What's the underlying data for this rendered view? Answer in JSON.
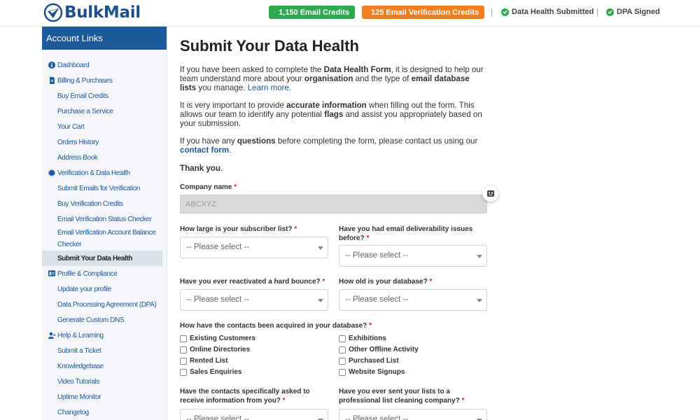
{
  "header": {
    "logo_text": "BulkMail",
    "email_credits": "1,150 Email Credits",
    "verification_credits": "125 Email Verification Credits",
    "separator": "|",
    "data_health_status": "Data Health Submitted",
    "dpa_status": "DPA Signed",
    "colors": {
      "brand": "#1e4f8f",
      "green": "#2fa84f",
      "orange": "#f37f20"
    }
  },
  "sidebar": {
    "title": "Account Links",
    "items": [
      {
        "label": "Dashboard",
        "type": "section",
        "icon": "info-icon"
      },
      {
        "label": "Billing & Purchases",
        "type": "section",
        "icon": "receipt-icon"
      },
      {
        "label": "Buy Email Credits",
        "type": "sub"
      },
      {
        "label": "Purchase a Service",
        "type": "sub"
      },
      {
        "label": "Your Cart",
        "type": "sub"
      },
      {
        "label": "Orders History",
        "type": "sub"
      },
      {
        "label": "Address Book",
        "type": "sub"
      },
      {
        "label": "Verification & Data Health",
        "type": "section",
        "icon": "badge-icon"
      },
      {
        "label": "Submit Emails for Verification",
        "type": "sub"
      },
      {
        "label": "Buy Verification Credits",
        "type": "sub"
      },
      {
        "label": "Email Verification Status Checker",
        "type": "sub"
      },
      {
        "label": "Email Verification Account Balance Checker",
        "type": "sub"
      },
      {
        "label": "Submit Your Data Health",
        "type": "sub",
        "active": true
      },
      {
        "label": "Profile & Compliance",
        "type": "section",
        "icon": "id-card-icon"
      },
      {
        "label": "Update your profile",
        "type": "sub"
      },
      {
        "label": "Data Processing Agreement (DPA)",
        "type": "sub"
      },
      {
        "label": "Generate Custom DNS",
        "type": "sub"
      },
      {
        "label": "Help & Learning",
        "type": "section",
        "icon": "user-help-icon"
      },
      {
        "label": "Submit a Ticket",
        "type": "sub"
      },
      {
        "label": "Knowledgebase",
        "type": "sub"
      },
      {
        "label": "Video Tutorials",
        "type": "sub"
      },
      {
        "label": "Uptime Monitor",
        "type": "sub"
      },
      {
        "label": "Changelog",
        "type": "sub"
      }
    ]
  },
  "main": {
    "title": "Submit Your Data Health",
    "p1": {
      "a": "If you have been asked to complete the ",
      "b": "Data Health Form",
      "c": ", it is designed to help our team understand more about your ",
      "d": "organisation",
      "e": " and the type of ",
      "f": "email database lists",
      "g": " you manage. ",
      "link": "Learn more."
    },
    "p2": {
      "a": "It is very important to provide ",
      "b": "accurate information",
      "c": " when filling out the form. This allows our team to identify any potential ",
      "d": "flags",
      "e": " and assist you appropriately based on your submission."
    },
    "p3": {
      "a": "If you have any ",
      "b": "questions",
      "c": " before completing the form, please contact us using our ",
      "link": "contact form",
      "d": "."
    },
    "p4": {
      "a": "Thank you",
      "b": "."
    },
    "form": {
      "required_mark": "*",
      "company_label": "Company name",
      "company_value": "ABCXYZ",
      "select_placeholder": "-- Please select --",
      "q_subscriber": "How large is your subscriber list?",
      "q_deliverability": "Have you had email deliverability issues before?",
      "q_reactivated": "Have you ever reactivated a hard bounce?",
      "q_age": "How old is your database?",
      "q_acquired": "How have the contacts been acquired in your database?",
      "checkboxes": [
        "Existing Customers",
        "Exhibitions",
        "Online Directories",
        "Other Offline Activity",
        "Rented List",
        "Purchased List",
        "Sales Enquiries",
        "Website Signups"
      ],
      "q_asked": "Have the contacts specifically asked to receive information from you?",
      "q_cleaning": "Have you ever sent your lists to a professional list cleaning company?"
    }
  }
}
